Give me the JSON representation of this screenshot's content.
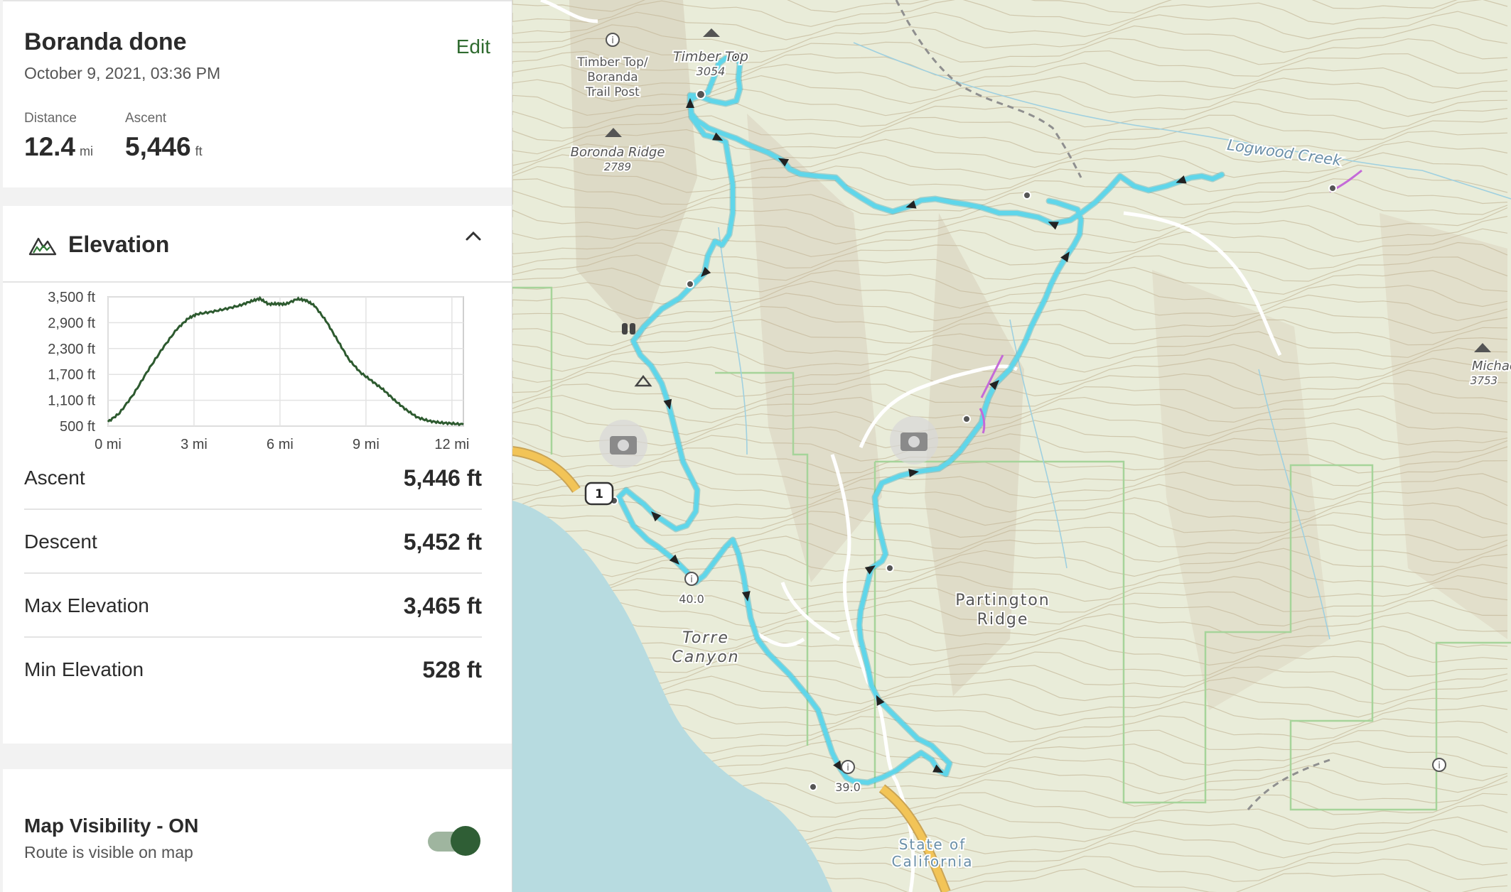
{
  "route": {
    "title": "Boranda done",
    "date": "October 9, 2021, 03:36 PM",
    "edit_label": "Edit",
    "distance_label": "Distance",
    "distance_value": "12.4",
    "distance_unit": "mi",
    "ascent_label": "Ascent",
    "ascent_value": "5,446",
    "ascent_unit": "ft"
  },
  "elevation": {
    "title": "Elevation",
    "icon": "mountain-icon",
    "collapse_icon": "chevron-up-icon",
    "stats": [
      {
        "label": "Ascent",
        "value": "5,446 ft"
      },
      {
        "label": "Descent",
        "value": "5,452 ft"
      },
      {
        "label": "Max Elevation",
        "value": "3,465 ft"
      },
      {
        "label": "Min Elevation",
        "value": "528 ft"
      }
    ]
  },
  "chart_data": {
    "type": "line",
    "title": "",
    "xlabel": "",
    "ylabel": "",
    "x_ticks": [
      "0 mi",
      "3 mi",
      "6 mi",
      "9 mi",
      "12 mi"
    ],
    "y_ticks": [
      "3,500 ft",
      "2,900 ft",
      "2,300 ft",
      "1,700 ft",
      "1,100 ft",
      "500 ft"
    ],
    "xlim": [
      0,
      12.4
    ],
    "ylim": [
      500,
      3500
    ],
    "grid": true,
    "line_color": "#2d5a2f",
    "series": [
      {
        "x": [
          0,
          0.4,
          0.9,
          1.4,
          1.9,
          2.4,
          2.8,
          3.1,
          3.6,
          4.1,
          4.6,
          5.0,
          5.3,
          5.6,
          5.9,
          6.2,
          6.6,
          6.9,
          7.2,
          7.6,
          8.0,
          8.4,
          8.8,
          9.2,
          9.6,
          10.0,
          10.4,
          10.8,
          11.2,
          11.6,
          12.0,
          12.4
        ],
        "y": [
          600,
          800,
          1250,
          1800,
          2300,
          2750,
          3000,
          3100,
          3150,
          3220,
          3300,
          3400,
          3460,
          3330,
          3340,
          3330,
          3450,
          3420,
          3300,
          2950,
          2500,
          2050,
          1750,
          1550,
          1350,
          1100,
          880,
          700,
          620,
          580,
          560,
          540
        ]
      }
    ]
  },
  "visibility": {
    "title": "Map Visibility - ON",
    "subtitle": "Route is visible on map",
    "on": true
  },
  "map": {
    "labels": {
      "timber_top_name": "Timber Top",
      "timber_top_elev": "3054",
      "trail_post_1": "Timber Top/",
      "trail_post_2": "Boranda",
      "trail_post_3": "Trail Post",
      "boronda_ridge": "Boronda Ridge",
      "boronda_ridge_elev": "2789",
      "logwood_creek": "Logwood Creek",
      "michaels_hill": "Michaels Hi",
      "michaels_hill_elev": "3753",
      "partington_1": "Partington",
      "partington_2": "Ridge",
      "torre_1": "Torre",
      "torre_2": "Canyon",
      "state_1": "State of",
      "state_2": "California",
      "hwy_shield": "1",
      "mile_40": "40.0",
      "mile_39": "39.0"
    },
    "colors": {
      "terrain": "#e9ecd9",
      "ocean": "#b7dbe0",
      "route": "#5fd6ea",
      "route_alt": "#c46ad8",
      "highway": "#f2c457",
      "contour": "#c5b89a",
      "park_boundary": "#a6d49a"
    }
  }
}
